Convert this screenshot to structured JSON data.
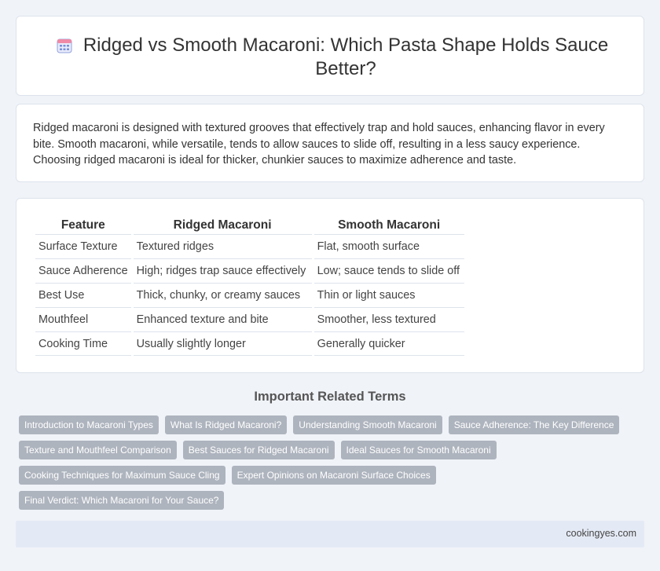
{
  "header": {
    "title": "Ridged vs Smooth Macaroni: Which Pasta Shape Holds Sauce Better?",
    "icon": "calendar-icon"
  },
  "intro": {
    "text": "Ridged macaroni is designed with textured grooves that effectively trap and hold sauces, enhancing flavor in every bite. Smooth macaroni, while versatile, tends to allow sauces to slide off, resulting in a less saucy experience. Choosing ridged macaroni is ideal for thicker, chunkier sauces to maximize adherence and taste."
  },
  "table": {
    "headers": [
      "Feature",
      "Ridged Macaroni",
      "Smooth Macaroni"
    ],
    "rows": [
      [
        "Surface Texture",
        "Textured ridges",
        "Flat, smooth surface"
      ],
      [
        "Sauce Adherence",
        "High; ridges trap sauce effectively",
        "Low; sauce tends to slide off"
      ],
      [
        "Best Use",
        "Thick, chunky, or creamy sauces",
        "Thin or light sauces"
      ],
      [
        "Mouthfeel",
        "Enhanced texture and bite",
        "Smoother, less textured"
      ],
      [
        "Cooking Time",
        "Usually slightly longer",
        "Generally quicker"
      ]
    ]
  },
  "related": {
    "heading": "Important Related Terms",
    "tags": [
      "Introduction to Macaroni Types",
      "What Is Ridged Macaroni?",
      "Understanding Smooth Macaroni",
      "Sauce Adherence: The Key Difference",
      "Texture and Mouthfeel Comparison",
      "Best Sauces for Ridged Macaroni",
      "Ideal Sauces for Smooth Macaroni",
      "Cooking Techniques for Maximum Sauce Cling",
      "Expert Opinions on Macaroni Surface Choices",
      "Final Verdict: Which Macaroni for Your Sauce?"
    ]
  },
  "footer": {
    "site": "cookingyes.com"
  },
  "colors": {
    "background": "#f0f3f8",
    "tag_bg": "#aeb4be",
    "footer_bg": "#e4eaf5",
    "icon_accent": "#7b8fd6"
  }
}
